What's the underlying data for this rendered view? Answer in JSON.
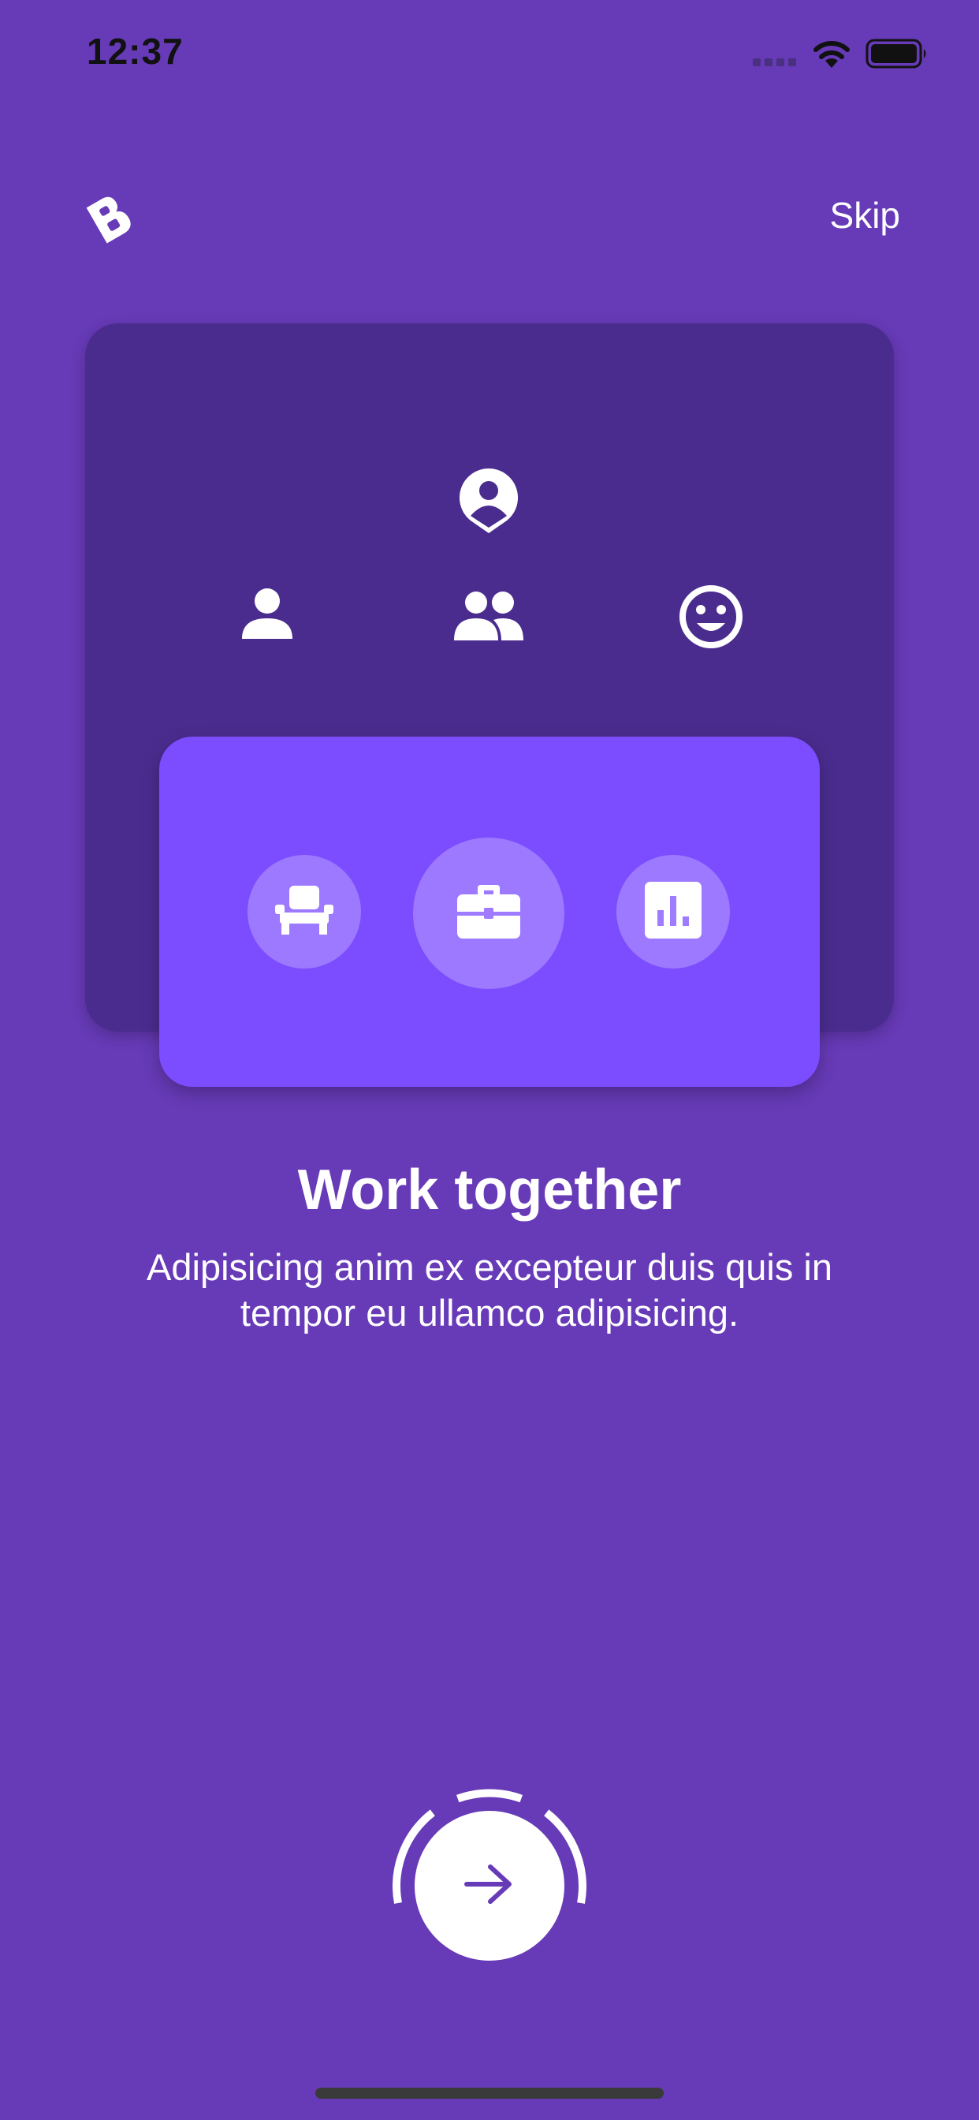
{
  "status_bar": {
    "time": "12:37"
  },
  "header": {
    "skip_label": "Skip",
    "logo_letter": "B"
  },
  "illustration": {
    "back_card_icons": [
      "account-pin-icon",
      "person-icon",
      "people-icon",
      "smiley-icon"
    ],
    "front_card_icons": [
      "chair-icon",
      "briefcase-icon",
      "bar-chart-icon"
    ]
  },
  "content": {
    "title": "Work together",
    "subtitle": "Adipisicing anim ex excepteur duis quis in tempor eu ullamco adipisicing."
  },
  "colors": {
    "background": "#673AB7",
    "back_card": "#4A2C8E",
    "front_card": "#7C4DFF",
    "next_arrow": "#673AB7"
  }
}
